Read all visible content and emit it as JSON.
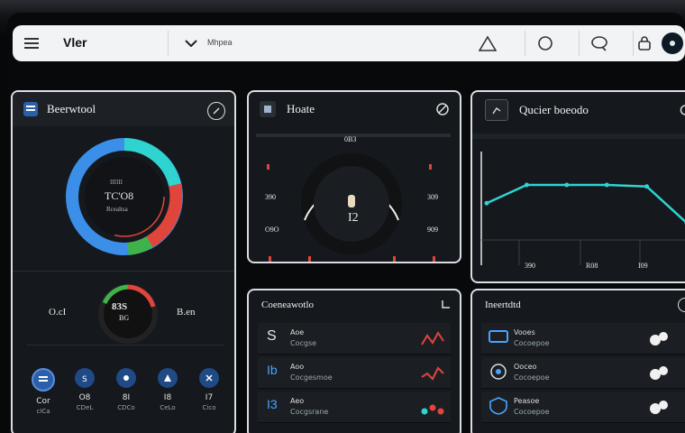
{
  "app": {
    "title": "Vler",
    "nav_label": "Mhpea"
  },
  "colors": {
    "accent": "#2fd3d0",
    "blue": "#3b8fe8",
    "red": "#e0453c",
    "green": "#3fb24a",
    "panel": "#15181c",
    "border": "#d9dde2"
  },
  "icons": {
    "menu": "menu-icon",
    "dropdown": "chevron-down-icon",
    "warning": "triangle-icon",
    "search": "circle-icon",
    "chat": "chat-icon",
    "lock": "lock-icon",
    "profile": "avatar-icon"
  },
  "overview": {
    "title": "Beerwtool",
    "donut": {
      "center_top": "IIIIII",
      "center_value": "TC'O8",
      "center_sub": "Rcealtsa"
    },
    "left_stat": "O.cI",
    "mid_stat": "83S",
    "mid_sub": "BG",
    "right_stat": "B.en",
    "chips": [
      {
        "value": "Cor",
        "sub": "cICa"
      },
      {
        "value": "O8",
        "sub": "CDeL"
      },
      {
        "value": "8I",
        "sub": "CDCo"
      },
      {
        "value": "I8",
        "sub": "CeLo"
      },
      {
        "value": "I7",
        "sub": "Cico"
      }
    ]
  },
  "monitor": {
    "title": "Hoate",
    "gauge": {
      "top": "0B3",
      "value": "I2",
      "left_mid": "390",
      "right_mid": "309",
      "left_low": "O9O",
      "right_low": "909"
    }
  },
  "trend": {
    "title": "Qucier boeodo",
    "x_labels": [
      "390",
      "R08",
      "I09"
    ],
    "points": [
      0.35,
      0.58,
      0.58,
      0.58,
      0.56,
      0.1
    ]
  },
  "list_one": {
    "title": "Coeneawotlo",
    "rows": [
      {
        "glyph": "S",
        "line1": "Aoe",
        "line2": "Cocgse"
      },
      {
        "glyph": "Ib",
        "line1": "Aoo",
        "line2": "Cocgesmoe"
      },
      {
        "glyph": "I3",
        "line1": "Aeo",
        "line2": "Cocgsrane"
      }
    ]
  },
  "list_two": {
    "title": "Ineertdtd",
    "rows": [
      {
        "line1": "Vooes",
        "line2": "Cocoepoe"
      },
      {
        "line1": "Ooceo",
        "line2": "Cocoepoe"
      },
      {
        "line1": "Peasoe",
        "line2": "Cocoepoe"
      }
    ]
  }
}
